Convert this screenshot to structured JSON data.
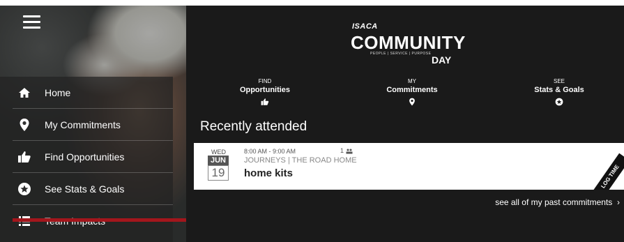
{
  "sidebar": {
    "items": [
      {
        "label": "Home",
        "icon": "home-icon"
      },
      {
        "label": "My Commitments",
        "icon": "map-pin-icon"
      },
      {
        "label": "Find Opportunities",
        "icon": "thumbs-up-icon"
      },
      {
        "label": "See Stats & Goals",
        "icon": "star-circle-icon"
      },
      {
        "label": "Team Impacts",
        "icon": "list-icon"
      }
    ],
    "accent": "#a3161c"
  },
  "logo": {
    "isaca": "ISACA",
    "word": "COMMUNITY",
    "tagline": "PEOPLE | SERVICE | PURPOSE",
    "day": "DAY"
  },
  "quick_links": [
    {
      "small": "FIND",
      "big": "Opportunities",
      "icon": "thumbs-up-icon"
    },
    {
      "small": "MY",
      "big": "Commitments",
      "icon": "map-pin-icon"
    },
    {
      "small": "SEE",
      "big": "Stats & Goals",
      "icon": "star-circle-icon"
    }
  ],
  "recent": {
    "title": "Recently attended",
    "card": {
      "dow": "WED",
      "month": "JUN",
      "day": "19",
      "time": "8:00 AM - 9:00 AM",
      "count": "1",
      "org": "JOURNEYS | THE ROAD HOME",
      "event": "home kits",
      "log_time": "LOG TIME"
    },
    "see_all": "see all of my past commitments"
  }
}
